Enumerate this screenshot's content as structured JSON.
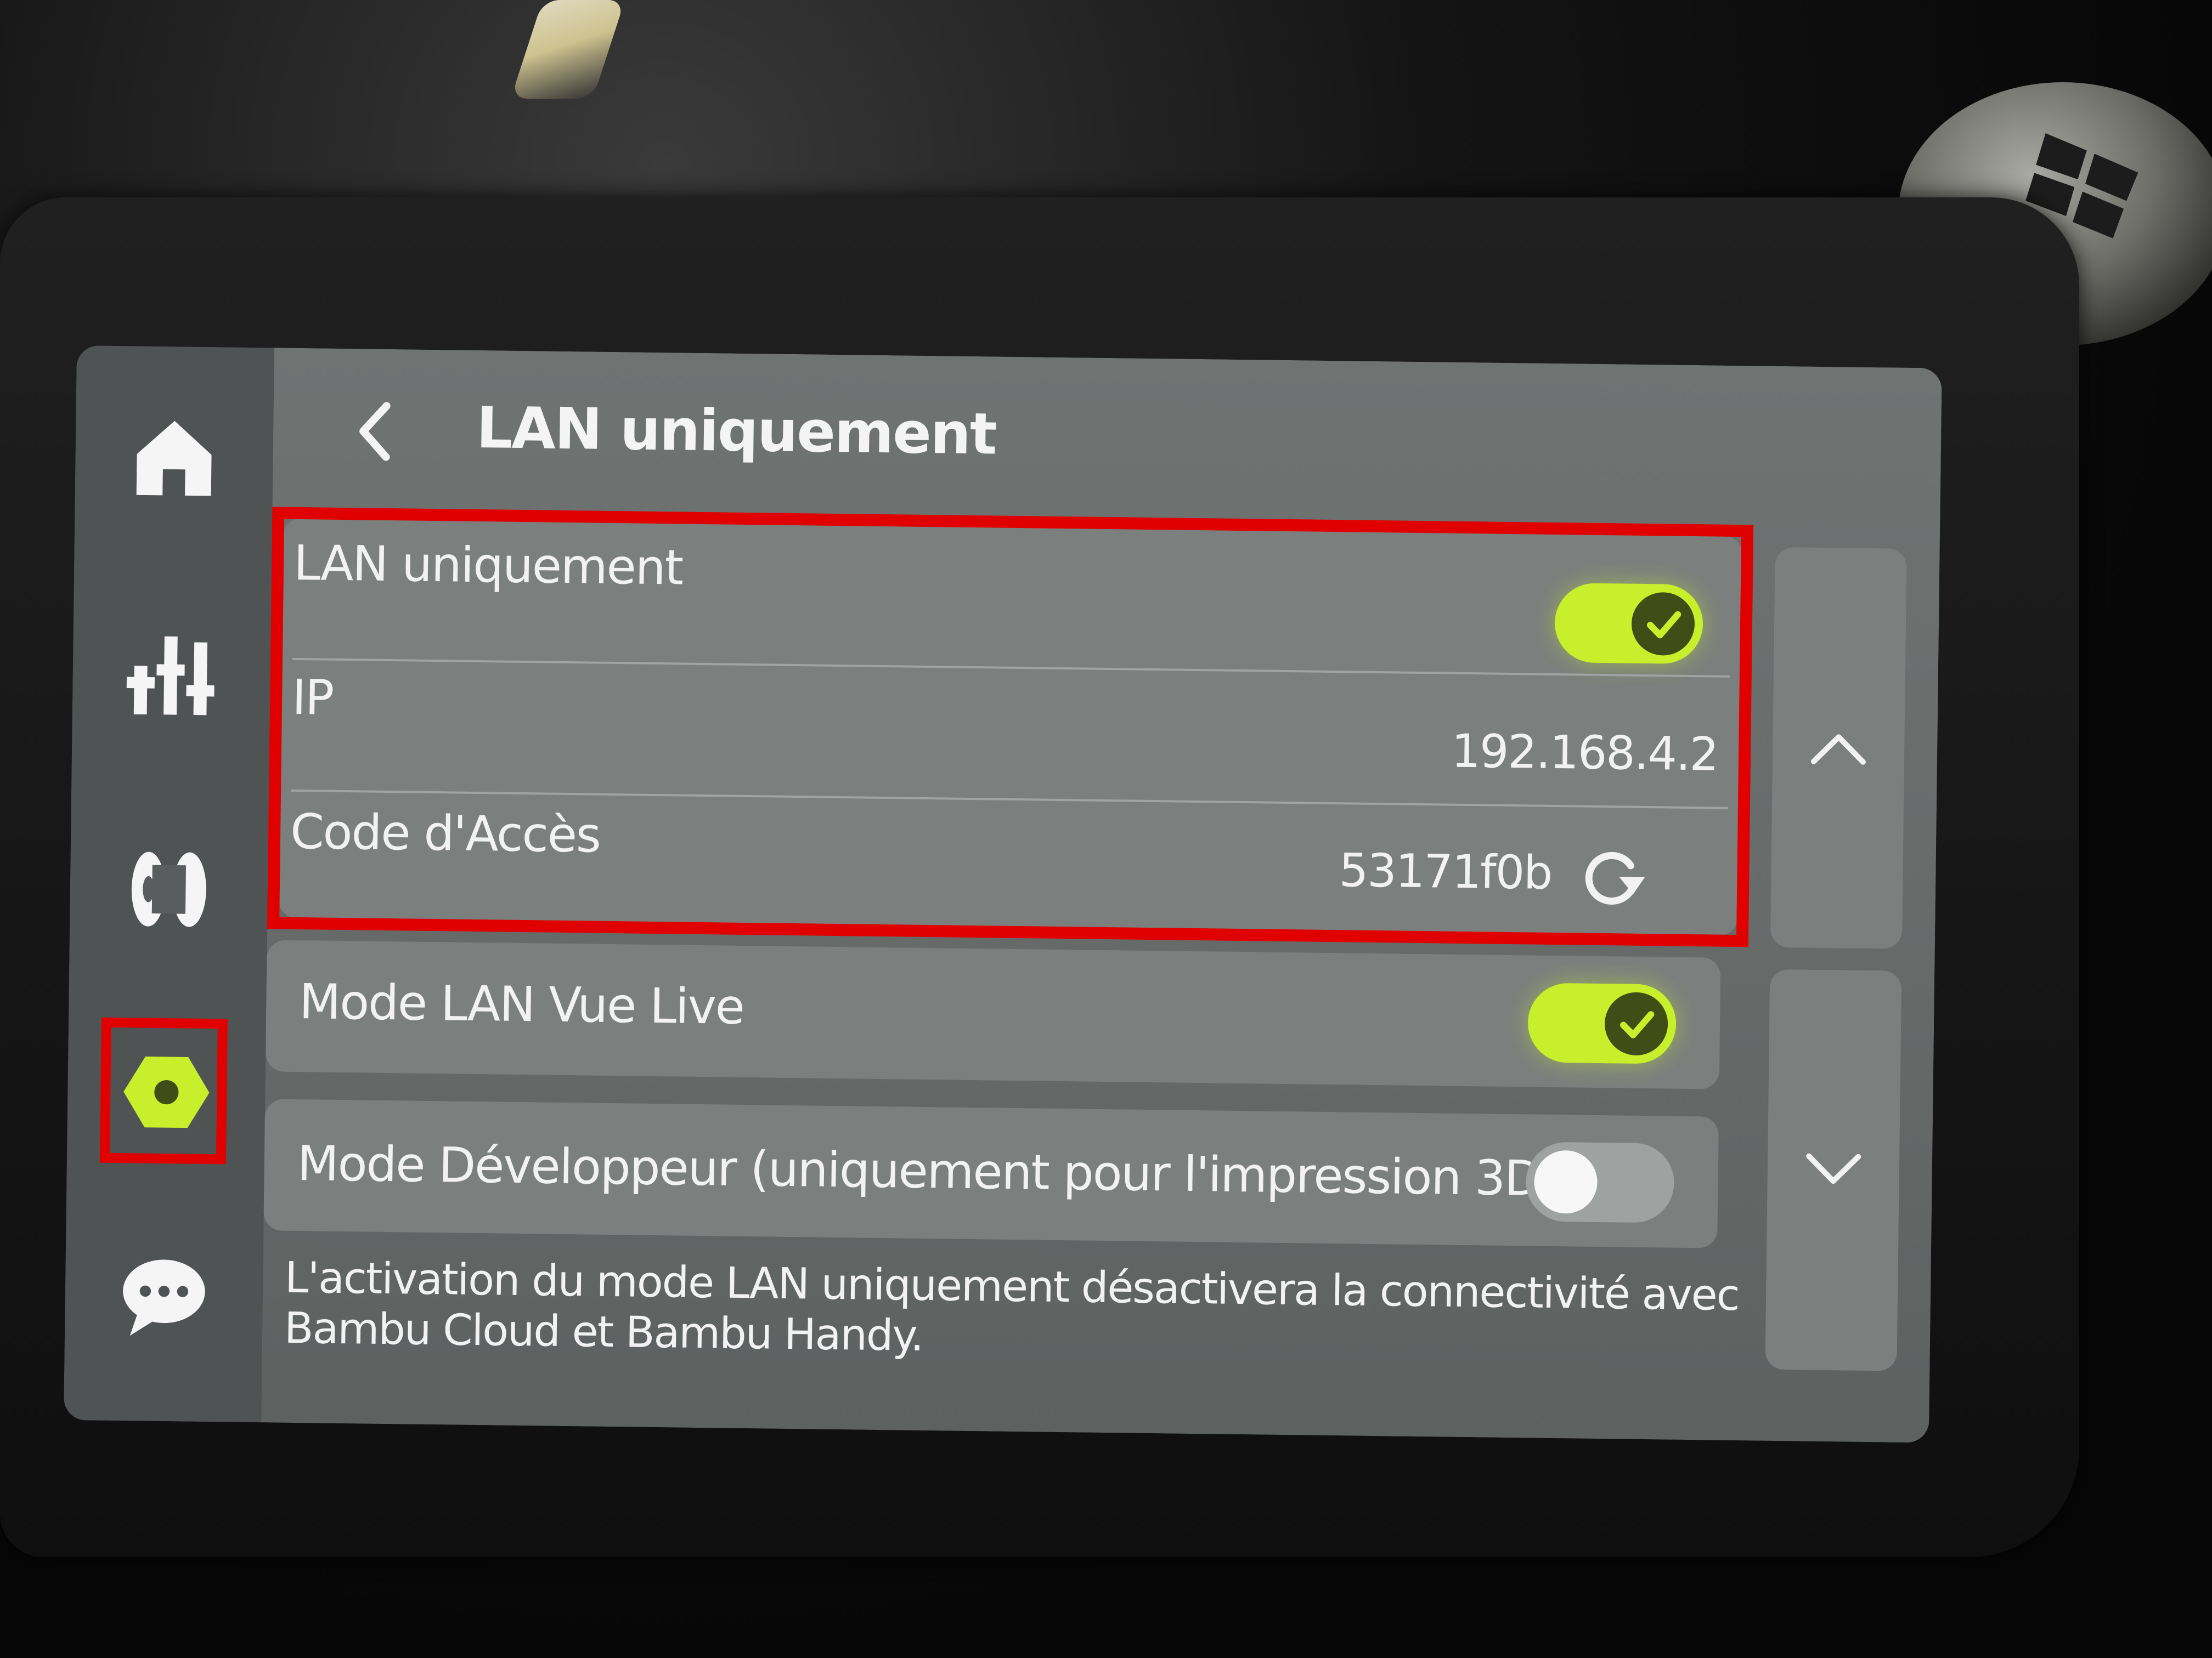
{
  "header": {
    "title": "LAN uniquement"
  },
  "sidebar": {
    "items": [
      {
        "icon": "home-icon"
      },
      {
        "icon": "controls-icon"
      },
      {
        "icon": "filament-spool-icon"
      },
      {
        "icon": "settings-nut-icon",
        "selected": true
      },
      {
        "icon": "chat-icon"
      }
    ]
  },
  "lan_card": {
    "lan_only": {
      "label": "LAN uniquement",
      "enabled": true
    },
    "ip": {
      "label": "IP",
      "value": "192.168.4.2"
    },
    "access_code": {
      "label": "Code d'Accès",
      "value": "53171f0b"
    }
  },
  "live_view": {
    "label": "Mode LAN Vue Live",
    "enabled": true
  },
  "developer_mode": {
    "label": "Mode Développeur (uniquement pour l'impression 3D)",
    "enabled": false,
    "help": "?"
  },
  "note": "L'activation du mode LAN uniquement désactivera la connectivité avec Bambu Cloud et Bambu Handy.",
  "colors": {
    "accent": "#c7ef2b",
    "annotation": "#e10000"
  }
}
